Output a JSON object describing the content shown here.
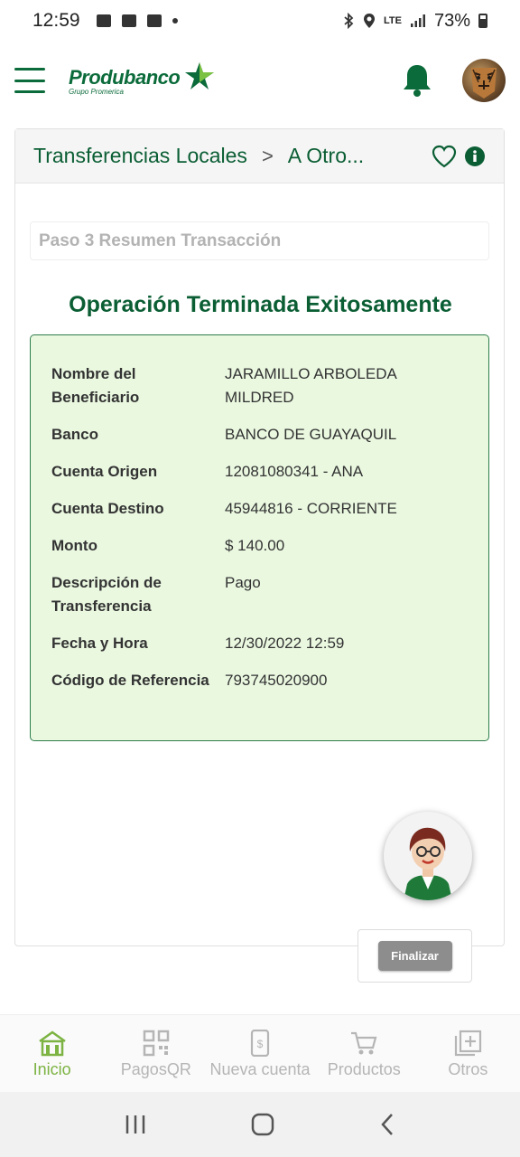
{
  "status_bar": {
    "time": "12:59",
    "battery": "73%",
    "network": "LTE"
  },
  "header": {
    "logo_name": "Produbanco",
    "logo_sub": "Grupo Promerica",
    "brand_color": "#0b6b3a"
  },
  "breadcrumb": {
    "first": "Transferencias Locales",
    "second": "A Otro..."
  },
  "step": {
    "label": "Paso 3 Resumen Transacción"
  },
  "result": {
    "title": "Operación Terminada Exitosamente"
  },
  "summary_rows": [
    {
      "label": "Nombre del Beneficiario",
      "value": "JARAMILLO ARBOLEDA MILDRED"
    },
    {
      "label": "Banco",
      "value": "BANCO DE GUAYAQUIL"
    },
    {
      "label": "Cuenta Origen",
      "value": "12081080341 - ANA"
    },
    {
      "label": "Cuenta Destino",
      "value": "45944816 - CORRIENTE"
    },
    {
      "label": "Monto",
      "value": "$ 140.00"
    },
    {
      "label": "Descripción de Transferencia",
      "value": "Pago"
    },
    {
      "label": "Fecha y Hora",
      "value": "12/30/2022 12:59"
    },
    {
      "label": "Código de Referencia",
      "value": "793745020900"
    }
  ],
  "actions": {
    "finalizar": "Finalizar"
  },
  "bottom_nav": [
    {
      "label": "Inicio",
      "icon": "home-icon",
      "active": true
    },
    {
      "label": "PagosQR",
      "icon": "qr-code-icon",
      "active": false
    },
    {
      "label": "Nueva cuenta",
      "icon": "phone-dollar-icon",
      "active": false
    },
    {
      "label": "Productos",
      "icon": "cart-icon",
      "active": false
    },
    {
      "label": "Otros",
      "icon": "plus-square-icon",
      "active": false
    }
  ],
  "colors": {
    "accent": "#0b5e34",
    "success_bg": "#eaf8e0",
    "active_nav": "#7cb342"
  }
}
